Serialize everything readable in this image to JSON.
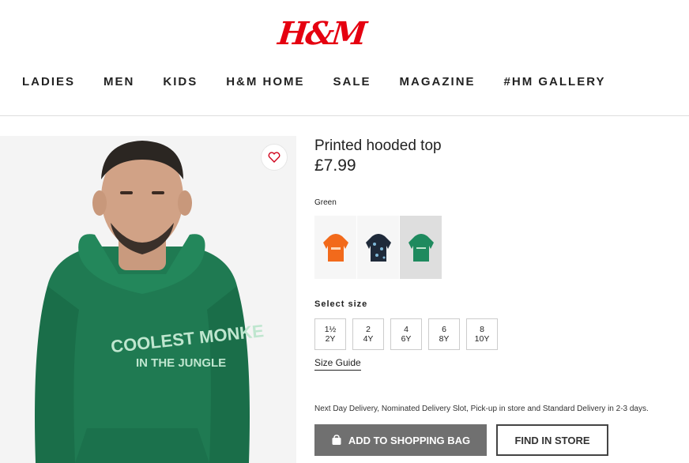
{
  "brand": {
    "logo_text": "H&M",
    "color": "#e50010"
  },
  "nav": {
    "items": [
      {
        "label": "LADIES"
      },
      {
        "label": "MEN"
      },
      {
        "label": "KIDS"
      },
      {
        "label": "H&M HOME"
      },
      {
        "label": "SALE"
      },
      {
        "label": "MAGAZINE"
      },
      {
        "label": "#HM GALLERY"
      }
    ]
  },
  "product": {
    "title": "Printed hooded top",
    "price": "£7.99",
    "hoodie_print_line1": "COOLEST MONKE",
    "hoodie_print_line2": "IN THE JUNGLE",
    "selected_color": "Green",
    "color_swatches": [
      {
        "color": "#f26a1b",
        "icon": "orange-hoodie-icon"
      },
      {
        "color": "#1f2a3a",
        "icon": "navy-print-hoodie-icon"
      },
      {
        "color": "#1e8a5e",
        "icon": "green-hoodie-icon",
        "selected": true
      }
    ],
    "size_label": "Select size",
    "sizes": [
      {
        "top": "1½",
        "bottom": "2Y"
      },
      {
        "top": "2",
        "bottom": "4Y"
      },
      {
        "top": "4",
        "bottom": "6Y"
      },
      {
        "top": "6",
        "bottom": "8Y"
      },
      {
        "top": "8",
        "bottom": "10Y"
      }
    ],
    "size_guide_label": "Size Guide",
    "delivery_text": "Next Day Delivery, Nominated Delivery Slot, Pick-up in store and Standard Delivery in 2-3 days.",
    "add_to_bag_label": "ADD TO SHOPPING BAG",
    "find_in_store_label": "FIND IN STORE"
  }
}
